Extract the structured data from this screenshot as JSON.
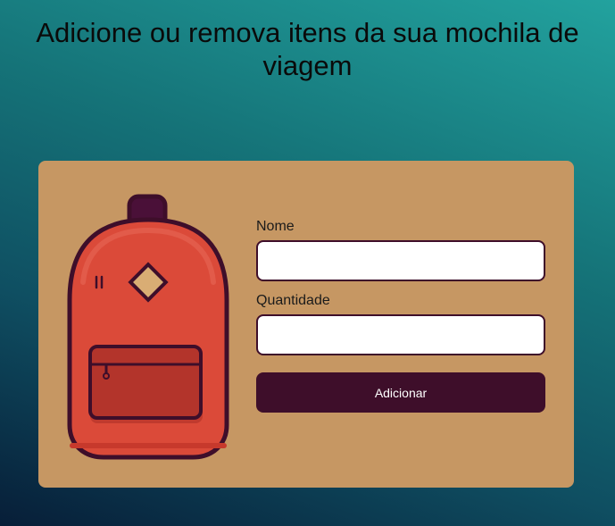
{
  "page": {
    "title": "Adicione ou remova itens da sua mochila de viagem"
  },
  "illustration": {
    "icon": "backpack-icon"
  },
  "form": {
    "name_label": "Nome",
    "name_value": "",
    "quantity_label": "Quantidade",
    "quantity_value": "",
    "submit_label": "Adicionar"
  },
  "colors": {
    "background_top": "#22a29e",
    "background_bottom": "#071e38",
    "card": "#c69763",
    "accent": "#3e0e2a",
    "backpack_body": "#db4a39",
    "backpack_pocket": "#b3342b",
    "badge": "#d9ad74"
  }
}
